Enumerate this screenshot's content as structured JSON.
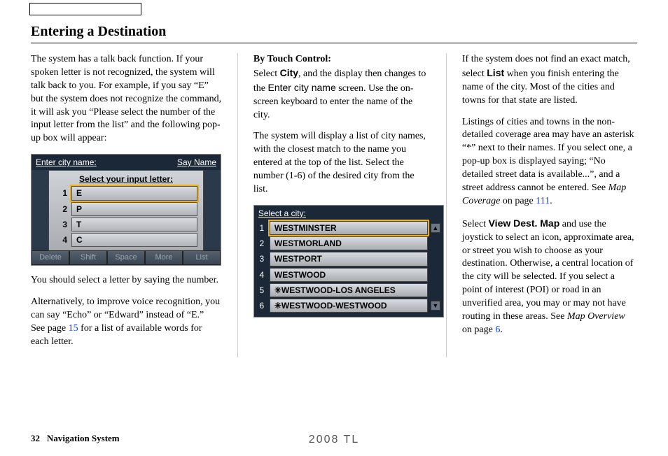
{
  "title": "Entering a Destination",
  "col1": {
    "p1": "The system has a talk back function. If your spoken letter is not recognized, the system will talk back to you. For example, if you say “E” but the system does not recognize the command, it will ask you “Please select the number of the input letter from the list” and the following pop-up box will appear:",
    "p2": "You should select a letter by saying the number.",
    "p3a": "Alternatively, to improve voice recognition, you can say “Echo” or “Edward” instead of “E.”",
    "p3b": "See page ",
    "p3link": "15",
    "p3c": " for a list of available words for each letter."
  },
  "shot1": {
    "header_left": "Enter city name:",
    "header_right": "Say Name",
    "popup_title": "Select your input letter:",
    "rows": [
      {
        "n": "1",
        "v": "E"
      },
      {
        "n": "2",
        "v": "P"
      },
      {
        "n": "3",
        "v": "T"
      },
      {
        "n": "4",
        "v": "C"
      }
    ],
    "buttons": [
      "Delete",
      "Shift",
      "Space",
      "More",
      "List"
    ]
  },
  "col2": {
    "h": "By Touch Control:",
    "p1a": "Select ",
    "p1b": "City",
    "p1c": ", and the display then changes to the ",
    "p1d": "Enter city name",
    "p1e": " screen. Use the on-screen keyboard to enter the name of the city.",
    "p2": "The system will display a list of city names, with the closest match to the name you entered at the top of the list. Select the number (1-6) of the desired city from the list."
  },
  "shot2": {
    "header": "Select a city:",
    "rows": [
      {
        "n": "1",
        "v": "WESTMINSTER"
      },
      {
        "n": "2",
        "v": "WESTMORLAND"
      },
      {
        "n": "3",
        "v": "WESTPORT"
      },
      {
        "n": "4",
        "v": "WESTWOOD"
      },
      {
        "n": "5",
        "v": "✳WESTWOOD-LOS ANGELES"
      },
      {
        "n": "6",
        "v": "✳WESTWOOD-WESTWOOD"
      }
    ]
  },
  "col3": {
    "p1a": "If the system does not find an exact match, select ",
    "p1b": "List",
    "p1c": " when you finish entering the name of the city. Most of the cities and towns for that state are listed.",
    "p2a": "Listings of cities and towns in the non-detailed coverage area may have an asterisk “*” next to their names. If you select one, a pop-up box is displayed saying; “No detailed street data is available...”, and a street address cannot be entered. See ",
    "p2b": "Map Coverage",
    "p2c": " on page ",
    "p2link": "111",
    "p2d": ".",
    "p3a": "Select ",
    "p3b": "View Dest. Map",
    "p3c": " and use the joystick to select an icon, approximate area, or street you wish to choose as your destination. Otherwise, a central location of the city will be selected. If you select a point of interest (POI) or road in an unverified area, you may or may not have routing in these areas. See ",
    "p3d": "Map Overview",
    "p3e": " on page ",
    "p3link": "6",
    "p3f": "."
  },
  "footer": {
    "page": "32",
    "section": "Navigation System",
    "model": "2008 TL"
  }
}
